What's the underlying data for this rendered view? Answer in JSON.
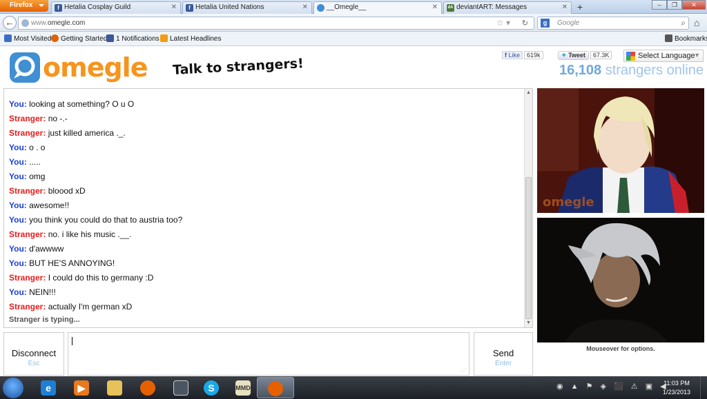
{
  "browser": {
    "menu_label": "Firefox",
    "tabs": [
      {
        "label": "Hetalia Cosplay Guild",
        "favicon": "f",
        "color": "#3b5998"
      },
      {
        "label": "Hetalia United Nations",
        "favicon": "f",
        "color": "#3b5998"
      },
      {
        "label": "__Omegle__",
        "favicon": "",
        "color": "#3f8fd2"
      },
      {
        "label": "deviantART: Messages",
        "favicon": "dA",
        "color": "#4d7a3a"
      }
    ],
    "new_tab": "+",
    "url_prefix": "www.",
    "url_domain": "omegle.com",
    "search_placeholder": "Google",
    "bookmarks": [
      "Most Visited",
      "Getting Started",
      "1 Notifications",
      "Latest Headlines"
    ],
    "bookmarks_menu": "Bookmarks"
  },
  "header": {
    "logo_text": "omegle",
    "tagline": "Talk to strangers!",
    "fb_like": "Like",
    "fb_count": "619k",
    "tweet": "Tweet",
    "tweet_count": "67.3K",
    "language": "Select Language",
    "online_count": "16,108",
    "online_label": "strangers online"
  },
  "chat": {
    "messages": [
      {
        "speaker": "You:",
        "type": "you",
        "text": "looking at something? O u O"
      },
      {
        "speaker": "Stranger:",
        "type": "stranger",
        "text": "no -.-"
      },
      {
        "speaker": "Stranger:",
        "type": "stranger",
        "text": "just killed america ._."
      },
      {
        "speaker": "You:",
        "type": "you",
        "text": "o . o"
      },
      {
        "speaker": "You:",
        "type": "you",
        "text": "....."
      },
      {
        "speaker": "You:",
        "type": "you",
        "text": "omg"
      },
      {
        "speaker": "Stranger:",
        "type": "stranger",
        "text": "bloood xD"
      },
      {
        "speaker": "You:",
        "type": "you",
        "text": "awesome!!"
      },
      {
        "speaker": "You:",
        "type": "you",
        "text": "you think you could do that to austria too?"
      },
      {
        "speaker": "Stranger:",
        "type": "stranger",
        "text": "no. i like his music .__."
      },
      {
        "speaker": "You:",
        "type": "you",
        "text": "d'awwww"
      },
      {
        "speaker": "You:",
        "type": "you",
        "text": "BUT HE'S ANNOYING!"
      },
      {
        "speaker": "Stranger:",
        "type": "stranger",
        "text": "I could do this to germany :D"
      },
      {
        "speaker": "You:",
        "type": "you",
        "text": "NEIN!!!"
      },
      {
        "speaker": "Stranger:",
        "type": "stranger",
        "text": "actually I'm german xD"
      }
    ],
    "typing": "Stranger is typing...",
    "disconnect_label": "Disconnect",
    "disconnect_hint": "Esc",
    "send_label": "Send",
    "send_hint": "Enter",
    "input_value": ""
  },
  "video": {
    "watermark": "omegle",
    "mouseover": "Mouseover for options."
  },
  "taskbar": {
    "time": "11:03 PM",
    "date": "1/23/2013"
  }
}
